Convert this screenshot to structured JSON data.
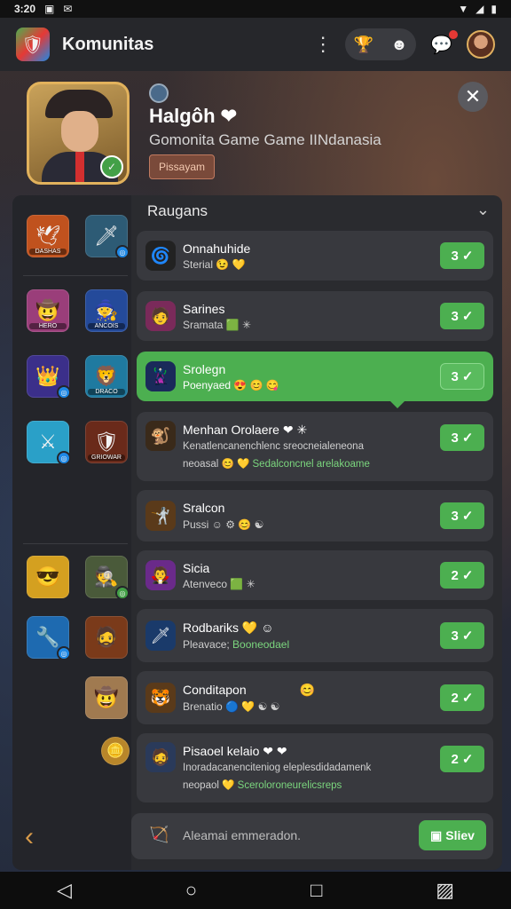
{
  "status": {
    "time": "3:20",
    "icon1": "▣",
    "icon2": "✉"
  },
  "appbar": {
    "title": "Komunitas",
    "menu": "⋮",
    "pill_icon1": "🏆",
    "pill_icon2": "☻",
    "chat_icon": "💬",
    "logo_icon": "🛡"
  },
  "header": {
    "title": "Halgôh ❤",
    "subtitle": "Gomonita Game Game IINdanasia",
    "tag": "Pissayam",
    "close": "✕"
  },
  "section": {
    "title": "Raugans",
    "chevron": "⌄"
  },
  "left_thumbs": [
    {
      "label": "DASHAS",
      "icon": "🕊"
    },
    {
      "label": "",
      "icon": "🗡"
    },
    {
      "label": "HERO",
      "icon": "🤠"
    },
    {
      "label": "ANCOIS",
      "icon": "🧙"
    },
    {
      "label": "",
      "icon": "👑"
    },
    {
      "label": "DRACO",
      "icon": "🦁"
    },
    {
      "label": "",
      "icon": "⚔"
    },
    {
      "label": "GRIOWAR",
      "icon": "🛡"
    },
    {
      "label": "",
      "icon": "😎"
    },
    {
      "label": "",
      "icon": "🕵"
    },
    {
      "label": "",
      "icon": "🔧"
    },
    {
      "label": "",
      "icon": "🧔"
    },
    {
      "label": "",
      "icon": "🤠"
    },
    {
      "label": "",
      "icon": "🪙"
    }
  ],
  "rows": [
    {
      "name": "Onnahuhide",
      "sub": "Sterial 😉 💛",
      "count": "3",
      "icon": "🌀"
    },
    {
      "name": "Sarines",
      "sub": "Sramata 🟩 ✳",
      "count": "3",
      "icon": "🧑"
    },
    {
      "name": "Srolegn",
      "sub": "Poenyaed 😍 😊 😋",
      "count": "3",
      "icon": "🦹"
    },
    {
      "name": "Menhan Orolaere ❤ ✳",
      "desc1": "Kenatlencanenchlenc sreocneialeneona",
      "desc2": "neoasal 😊 💛",
      "desc2_green": "Sedalconcnel arelakoame",
      "count": "3",
      "icon": "🐒"
    },
    {
      "name": "Sralcon",
      "sub": "Pussi ☺ ⚙ 😊 ☯",
      "count": "3",
      "icon": "🤺"
    },
    {
      "name": "Sicia",
      "sub": "Atenveco 🟩 ✳",
      "count": "2",
      "icon": "🧛"
    },
    {
      "name": "Rodbariks 💛 ☺",
      "sub": "Pleavace;",
      "sub_green": "Booneodael",
      "count": "3",
      "icon": "🗡"
    },
    {
      "name": "Conditapon",
      "extra": "😊",
      "sub": "Brenatio 🔵 💛 ☯ ☯",
      "count": "2",
      "icon": "🐯"
    },
    {
      "name": "Pisaoel kelaio ❤ ❤",
      "desc1": "Inoradacanenciteniog eleplesdidadamenk",
      "desc2": "neopaol 💛",
      "desc2_green": "Sceroloroneurelicsreps",
      "count": "2",
      "icon": "🧔"
    }
  ],
  "check": "✓",
  "composer": {
    "placeholder": "Aleamai emmeradon.",
    "send_label": "Sliev",
    "send_icon": "▣",
    "icon": "🏹",
    "back": "‹"
  },
  "nav": {
    "back": "◁",
    "home": "○",
    "recent": "□",
    "extra": "▨"
  }
}
